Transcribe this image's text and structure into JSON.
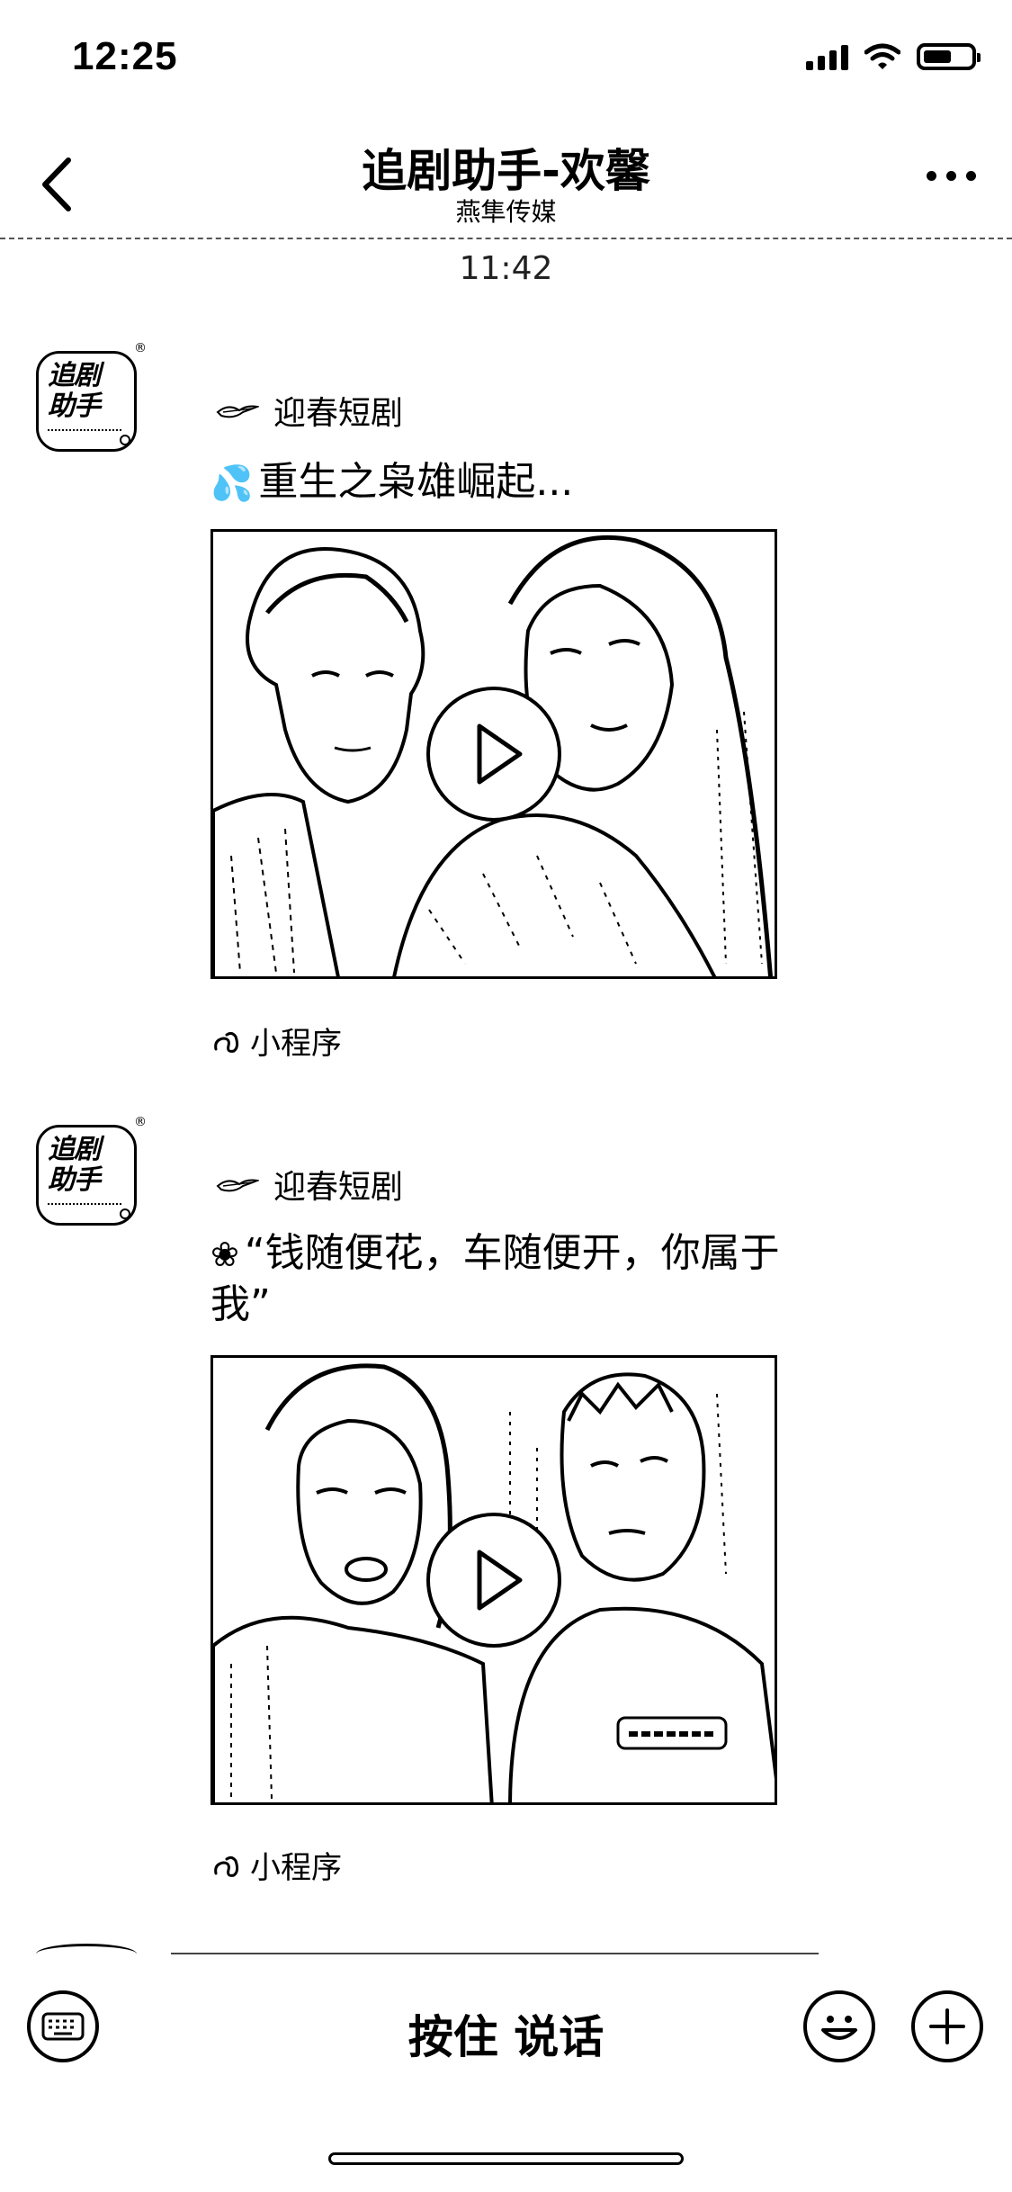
{
  "status_bar": {
    "time": "12:25",
    "battery_level": 0.45
  },
  "nav": {
    "title": "追剧助手-欢馨",
    "subtitle": "燕隼传媒",
    "back_icon": "chevron-left-icon",
    "more_icon": "more-dots-icon"
  },
  "chat": {
    "timestamp": "11:42",
    "messages": [
      {
        "avatar_text_line1": "追剧",
        "avatar_text_line2": "助手",
        "source": "迎春短剧",
        "caption_emoji": "💦",
        "caption": "重生之枭雄崛起...",
        "mini_program_label": "小程序"
      },
      {
        "avatar_text_line1": "追剧",
        "avatar_text_line2": "助手",
        "source": "迎春短剧",
        "caption_emoji": "❀",
        "caption": "“钱随便花，车随便开，你属于我”",
        "mini_program_label": "小程序"
      }
    ]
  },
  "input_bar": {
    "hold_to_talk": "按住 说话",
    "keyboard_icon": "keyboard-icon",
    "emoji_icon": "smiley-icon",
    "plus_icon": "plus-icon"
  }
}
